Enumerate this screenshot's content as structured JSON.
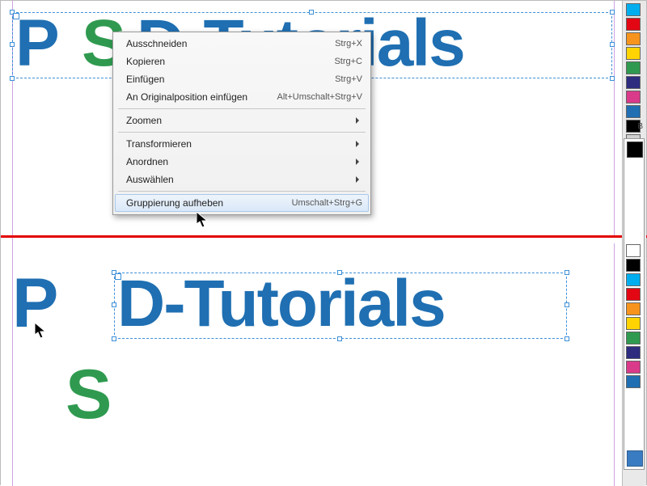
{
  "top_text": {
    "p": "P",
    "s": "S",
    "rest": "D-Tutorials"
  },
  "bottom_text": {
    "p": "P",
    "s": "S",
    "rest": "D-Tutorials"
  },
  "context_menu": {
    "items": [
      {
        "label": "Ausschneiden",
        "shortcut": "Strg+X",
        "submenu": false
      },
      {
        "label": "Kopieren",
        "shortcut": "Strg+C",
        "submenu": false
      },
      {
        "label": "Einfügen",
        "shortcut": "Strg+V",
        "submenu": false
      },
      {
        "label": "An Originalposition einfügen",
        "shortcut": "Alt+Umschalt+Strg+V",
        "submenu": false
      }
    ],
    "items2": [
      {
        "label": "Zoomen",
        "shortcut": "",
        "submenu": true
      }
    ],
    "items3": [
      {
        "label": "Transformieren",
        "shortcut": "",
        "submenu": true
      },
      {
        "label": "Anordnen",
        "shortcut": "",
        "submenu": true
      },
      {
        "label": "Auswählen",
        "shortcut": "",
        "submenu": true
      }
    ],
    "highlight": {
      "label": "Gruppierung aufheben",
      "shortcut": "Umschalt+Strg+G"
    }
  },
  "swatches_top": [
    "#00aeef",
    "#e30613",
    "#f7941d",
    "#ffd400",
    "#2f9a4f",
    "#2d2c7f",
    "#d93a8a",
    "#1f6fb2",
    "#000000",
    "#d0d0d0"
  ],
  "swatches_bottom": [
    "#ffffff",
    "#000000",
    "#00aeef",
    "#e30613",
    "#f7941d",
    "#ffd400",
    "#2f9a4f",
    "#2d2c7f",
    "#d93a8a",
    "#1f6fb2"
  ],
  "sidebar_label_top": "B",
  "colors": {
    "blue": "#1f6fb2",
    "green": "#2f9a4f",
    "divider": "#e30000"
  }
}
